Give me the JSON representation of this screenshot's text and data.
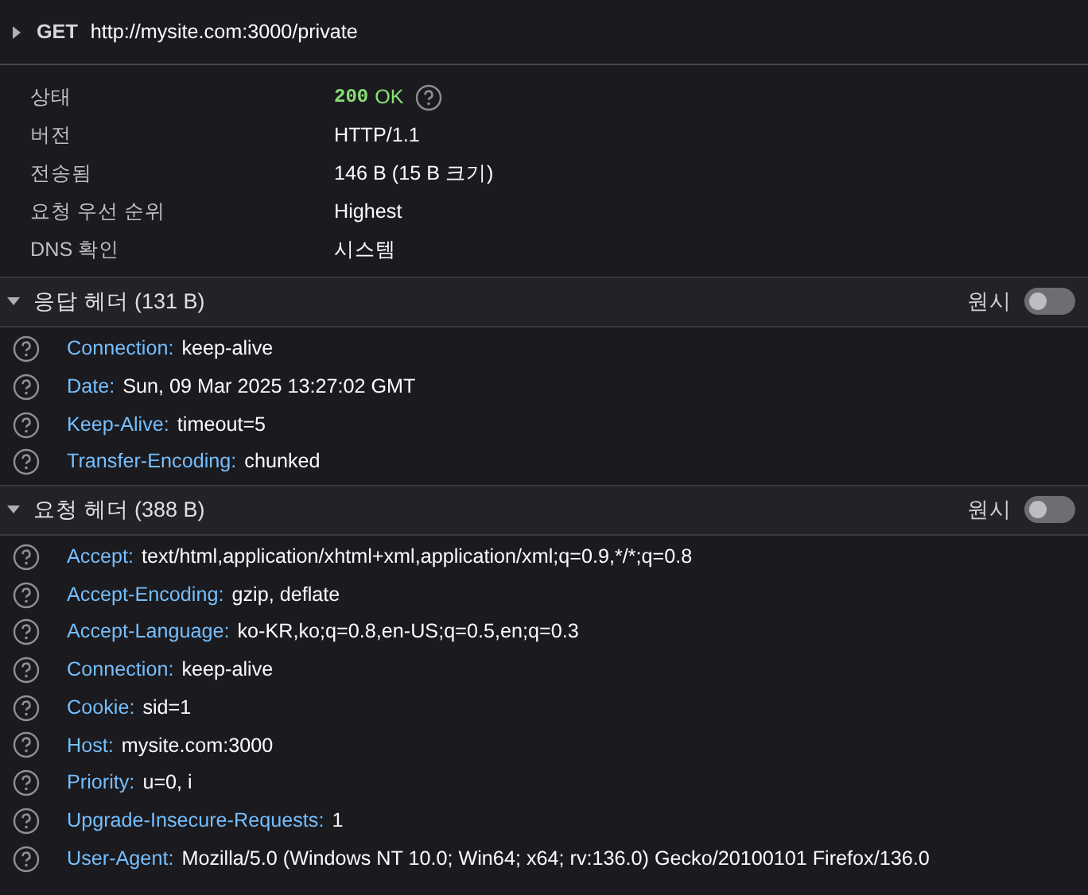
{
  "request": {
    "expanded": false,
    "method": "GET",
    "url": "http://mysite.com:3000/private"
  },
  "summary": [
    {
      "kind": "status",
      "label": "상태",
      "code": "200",
      "text": "OK"
    },
    {
      "kind": "text",
      "label": "버전",
      "value": "HTTP/1.1"
    },
    {
      "kind": "text",
      "label": "전송됨",
      "value": "146 B (15 B 크기)"
    },
    {
      "kind": "text",
      "label": "요청 우선 순위",
      "value": "Highest"
    },
    {
      "kind": "text",
      "label": "DNS 확인",
      "value": "시스템"
    }
  ],
  "sections": [
    {
      "title": "응답 헤더 (131 B)",
      "expanded": true,
      "raw_label": "원시",
      "raw_on": false,
      "headers": [
        {
          "name": "Connection:",
          "value": "keep-alive"
        },
        {
          "name": "Date:",
          "value": "Sun, 09 Mar 2025 13:27:02 GMT"
        },
        {
          "name": "Keep-Alive:",
          "value": "timeout=5"
        },
        {
          "name": "Transfer-Encoding:",
          "value": "chunked"
        }
      ]
    },
    {
      "title": "요청 헤더 (388 B)",
      "expanded": true,
      "raw_label": "원시",
      "raw_on": false,
      "headers": [
        {
          "name": "Accept:",
          "value": "text/html,application/xhtml+xml,application/xml;q=0.9,*/*;q=0.8"
        },
        {
          "name": "Accept-Encoding:",
          "value": "gzip, deflate"
        },
        {
          "name": "Accept-Language:",
          "value": "ko-KR,ko;q=0.8,en-US;q=0.5,en;q=0.3"
        },
        {
          "name": "Connection:",
          "value": "keep-alive"
        },
        {
          "name": "Cookie:",
          "value": "sid=1"
        },
        {
          "name": "Host:",
          "value": "mysite.com:3000"
        },
        {
          "name": "Priority:",
          "value": "u=0, i"
        },
        {
          "name": "Upgrade-Insecure-Requests:",
          "value": "1"
        },
        {
          "name": "User-Agent:",
          "value": "Mozilla/5.0 (Windows NT 10.0; Win64; x64; rv:136.0) Gecko/20100101 Firefox/136.0"
        }
      ]
    }
  ]
}
